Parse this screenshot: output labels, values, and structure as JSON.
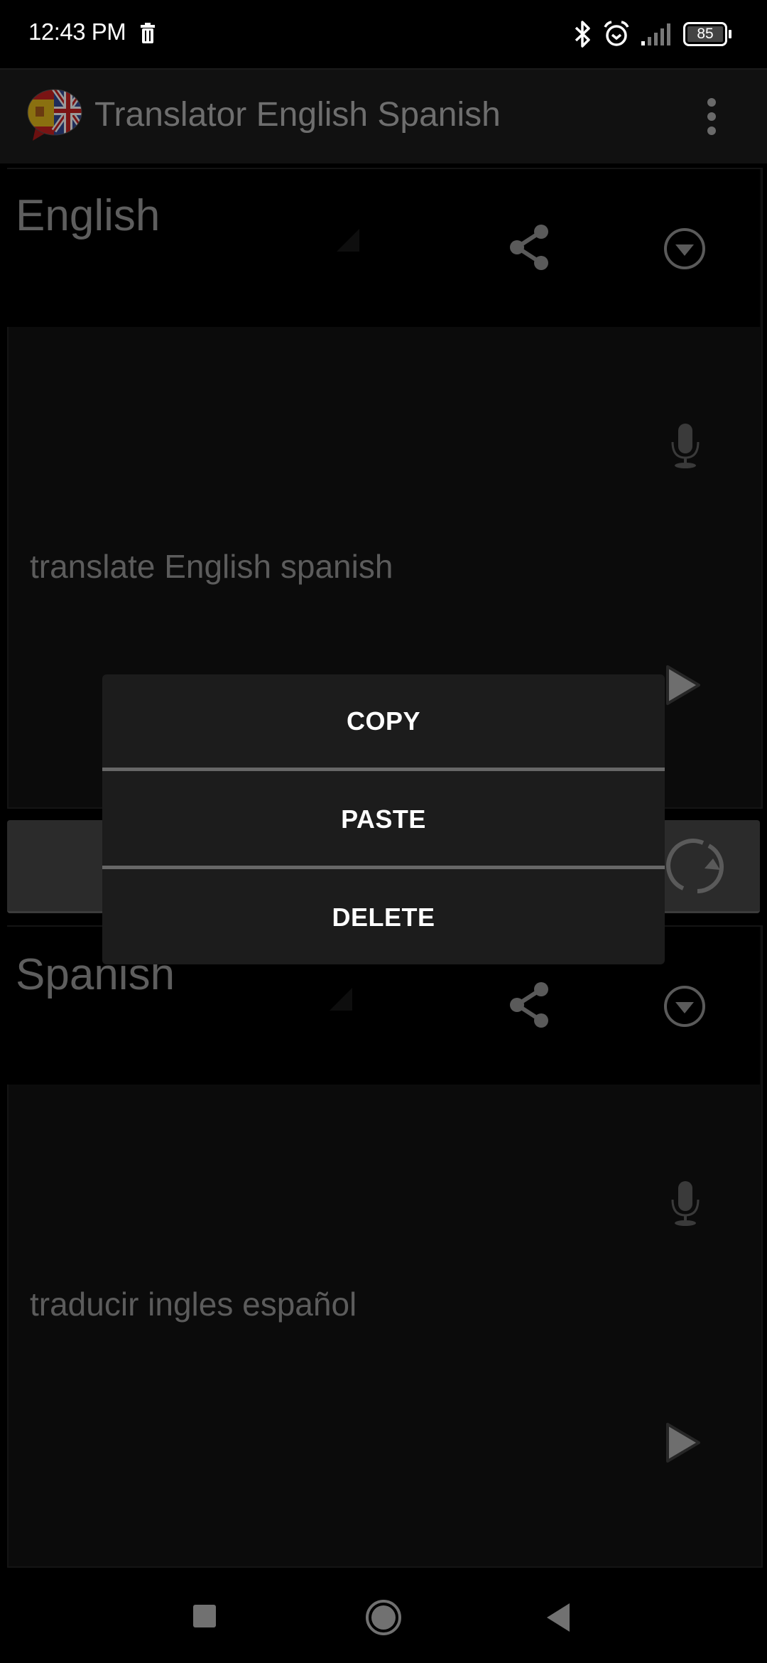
{
  "status_bar": {
    "time": "12:43 PM",
    "battery_level": "85",
    "icons": [
      "trash-icon",
      "bluetooth-icon",
      "alarm-icon",
      "signal-icon",
      "battery-icon"
    ]
  },
  "app_bar": {
    "title": "Translator English Spanish",
    "logo": "spain-uk-flag-logo",
    "menu_icon": "overflow-menu-icon"
  },
  "source_panel": {
    "language": "English",
    "text": "translate English spanish",
    "icons": [
      "share-icon",
      "dropdown-icon",
      "microphone-icon",
      "play-icon"
    ]
  },
  "translate_bar": {
    "icon": "swap-refresh-icon"
  },
  "target_panel": {
    "language": "Spanish",
    "text": "traducir ingles español",
    "icons": [
      "share-icon",
      "dropdown-icon",
      "microphone-icon",
      "play-icon"
    ]
  },
  "context_menu": {
    "items": [
      {
        "label": "COPY"
      },
      {
        "label": "PASTE"
      },
      {
        "label": "DELETE"
      }
    ]
  },
  "nav_bar": {
    "buttons": [
      "recents",
      "home",
      "back"
    ]
  },
  "colors": {
    "menu_background": "#1c1c1c",
    "menu_separator": "#676767",
    "menu_text": "#ffffff",
    "dimmed_text": "#5e5e5e"
  }
}
